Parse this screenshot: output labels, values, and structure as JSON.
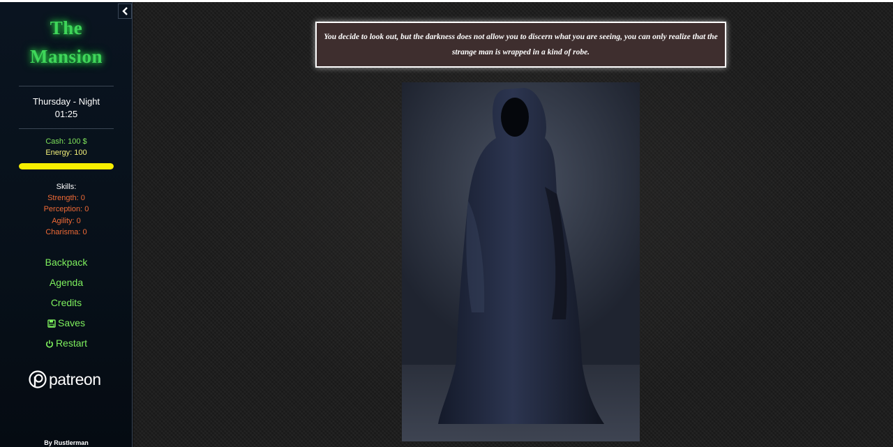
{
  "sidebar": {
    "collapse_icon": "chevron-left-icon",
    "title_line1": "The",
    "title_line2": "Mansion",
    "day": "Thursday - Night",
    "time": "01:25",
    "cash": "Cash: 100 $",
    "energy": "Energy: 100",
    "energy_level": 1.0,
    "skills_label": "Skills:",
    "skills": [
      {
        "label": "Strength: 0"
      },
      {
        "label": "Perception: 0"
      },
      {
        "label": "Agility: 0"
      },
      {
        "label": "Charisma: 0"
      }
    ],
    "menu": {
      "backpack": "Backpack",
      "agenda": "Agenda",
      "credits": "Credits",
      "saves": "Saves",
      "restart": "Restart"
    },
    "patreon": "patreon",
    "author": "By Rustlerman"
  },
  "main": {
    "narration": "You decide to look out, but the darkness does not allow you to discern what you are seeing, you can only realize that the strange man is wrapped in a kind of robe."
  },
  "colors": {
    "title": "#3fd65a",
    "cash": "#7ee35a",
    "energy": "#f2f07a",
    "energy_bar": "#f7ef00",
    "skill": "#f06a36",
    "menu": "#7ef05e",
    "narration_bg": "#3e2e2e"
  }
}
